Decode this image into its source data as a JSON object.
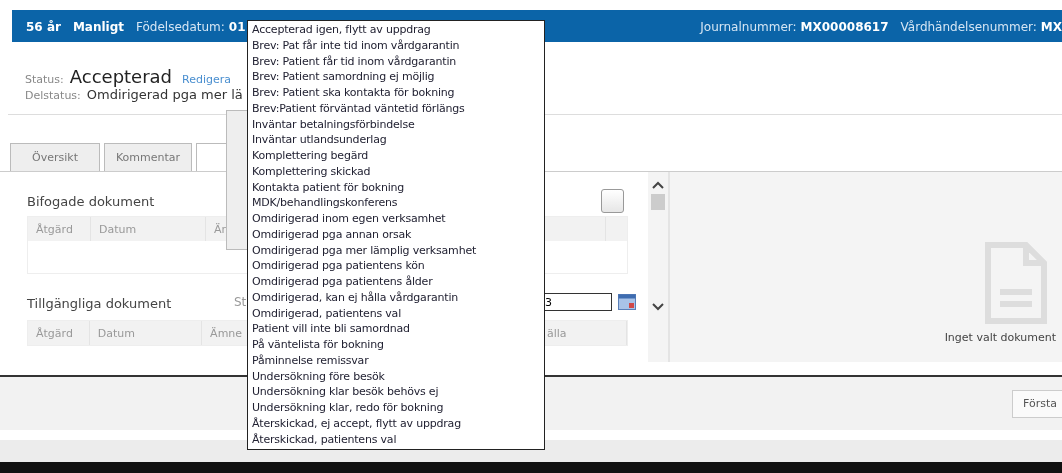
{
  "header": {
    "age": "56 år",
    "sex": "Manligt",
    "birth_label": "Födelsedatum:",
    "birth_value": "01",
    "journal_label": "Journalnummer:",
    "journal_value": "MX00008617",
    "event_label": "Vårdhändelsenummer:",
    "event_value": "MX"
  },
  "status": {
    "label": "Status:",
    "value": "Accepterad",
    "edit_link": "Redigera",
    "sub_label": "Delstatus:",
    "sub_value": "Omdirigerad pga mer lä"
  },
  "tabs": [
    {
      "label": "Översikt",
      "selected": false
    },
    {
      "label": "Kommentar",
      "selected": false
    },
    {
      "selected": true
    }
  ],
  "attached": {
    "title": "Bifogade dokument",
    "checked": false,
    "columns": [
      "Åtgärd",
      "Datum",
      "Än"
    ]
  },
  "available": {
    "title": "Tillgängliga dokument",
    "filter_label": "St",
    "date_value": "3",
    "columns": [
      "Åtgärd",
      "Datum",
      "Ämne",
      "älla"
    ]
  },
  "preview": {
    "empty_text": "Inget valt dokument"
  },
  "footer": {
    "button": "Första"
  },
  "dropdown": {
    "items": [
      "Accepterad igen, flytt av uppdrag",
      "Brev: Pat får inte tid inom vårdgarantin",
      "Brev: Patient får tid inom vårdgarantin",
      "Brev: Patient samordning ej möjlig",
      "Brev: Patient ska kontakta för bokning",
      "Brev:Patient förväntad väntetid förlängs",
      "Inväntar betalningsförbindelse",
      "Inväntar utlandsunderlag",
      "Komplettering begärd",
      "Komplettering skickad",
      "Kontakta patient för bokning",
      "MDK/behandlingskonferens",
      "Omdirigerad inom egen verksamhet",
      "Omdirigerad pga annan orsak",
      "Omdirigerad pga mer lämplig verksamhet",
      "Omdirigerad pga patientens kön",
      "Omdirigerad pga patientens ålder",
      "Omdirigerad, kan ej hålla vårdgarantin",
      "Omdirigerad, patientens val",
      "Patient vill inte bli samordnad",
      "På väntelista för bokning",
      "Påminnelse remissvar",
      "Undersökning före besök",
      "Undersökning klar besök behövs ej",
      "Undersökning klar, redo för bokning",
      "Återskickad, ej accept, flytt av uppdrag",
      "Återskickad, patientens val"
    ]
  }
}
